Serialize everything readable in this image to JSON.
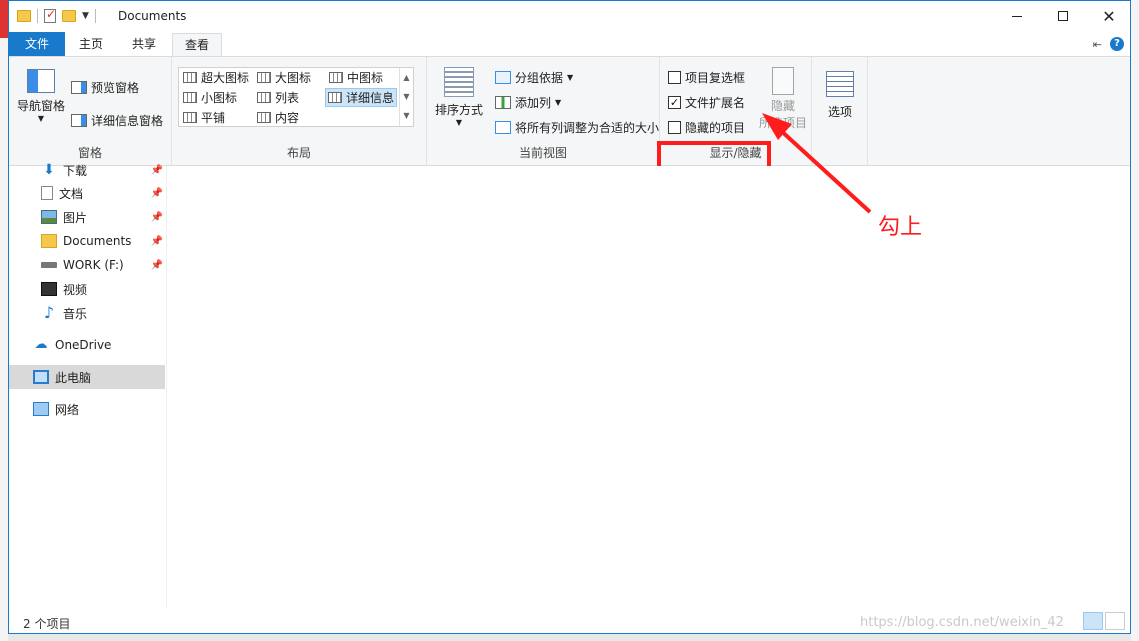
{
  "window": {
    "title": "Documents"
  },
  "ribbon_tabs": [
    {
      "label": "文件"
    },
    {
      "label": "主页"
    },
    {
      "label": "共享"
    },
    {
      "label": "查看"
    }
  ],
  "ribbon": {
    "panes": {
      "nav_pane_label": "导航窗格",
      "preview_pane_label": "预览窗格",
      "details_pane_label": "详细信息窗格",
      "group_label": "窗格"
    },
    "layout": {
      "items": [
        {
          "label": "超大图标"
        },
        {
          "label": "大图标"
        },
        {
          "label": "中图标"
        },
        {
          "label": "小图标"
        },
        {
          "label": "列表"
        },
        {
          "label": "详细信息"
        },
        {
          "label": "平铺"
        },
        {
          "label": "内容"
        }
      ],
      "selected": "详细信息",
      "group_label": "布局"
    },
    "current_view": {
      "sort_label": "排序方式",
      "group_by_label": "分组依据",
      "add_column_label": "添加列",
      "fit_columns_label": "将所有列调整为合适的大小",
      "group_label": "当前视图"
    },
    "show_hide": {
      "item_checkboxes_label": "项目复选框",
      "item_checkboxes_checked": false,
      "file_extensions_label": "文件扩展名",
      "file_extensions_checked": true,
      "hidden_items_label": "隐藏的项目",
      "hidden_items_checked": false,
      "hide_selected_label_1": "隐藏",
      "hide_selected_label_2": "所选项目",
      "group_label": "显示/隐藏"
    },
    "options": {
      "label": "选项"
    }
  },
  "nav_pane": {
    "items": [
      {
        "label": "下载",
        "icon": "download-icon",
        "pinned": true
      },
      {
        "label": "文档",
        "icon": "document-icon",
        "pinned": true
      },
      {
        "label": "图片",
        "icon": "picture-icon",
        "pinned": true
      },
      {
        "label": "Documents",
        "icon": "folder-icon",
        "pinned": true
      },
      {
        "label": "WORK (F:)",
        "icon": "drive-icon",
        "pinned": true
      },
      {
        "label": "视频",
        "icon": "video-icon",
        "pinned": false
      },
      {
        "label": "音乐",
        "icon": "music-icon",
        "pinned": false
      },
      {
        "label": "OneDrive",
        "icon": "onedrive-icon",
        "pinned": false
      },
      {
        "label": "此电脑",
        "icon": "this-pc-icon",
        "pinned": false,
        "selected": true
      },
      {
        "label": "网络",
        "icon": "network-icon",
        "pinned": false
      }
    ]
  },
  "status": {
    "item_count": "2 个项目",
    "watermark": "https://blog.csdn.net/weixin_42"
  },
  "annotation": {
    "text": "勾上",
    "color": "#ff1c1c"
  },
  "colors": {
    "accent": "#1979ca",
    "highlight": "#ff1c1c"
  }
}
